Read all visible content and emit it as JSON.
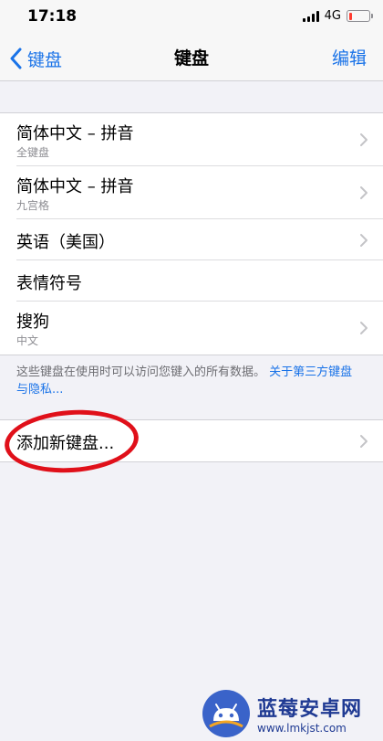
{
  "status": {
    "time": "17:18",
    "network": "4G"
  },
  "nav": {
    "back_label": "键盘",
    "title": "键盘",
    "edit_label": "编辑"
  },
  "keyboards": [
    {
      "title": "简体中文 – 拼音",
      "subtitle": "全键盘"
    },
    {
      "title": "简体中文 – 拼音",
      "subtitle": "九宫格"
    },
    {
      "title": "英语（美国）"
    },
    {
      "title": "表情符号"
    },
    {
      "title": "搜狗",
      "subtitle": "中文"
    }
  ],
  "footer": {
    "note": "这些键盘在使用时可以访问您键入的所有数据。",
    "link": "关于第三方键盘与隐私..."
  },
  "add_keyboard": {
    "label": "添加新键盘..."
  },
  "watermark": {
    "name": "蓝莓安卓网",
    "url": "www.lmkjst.com"
  },
  "colors": {
    "accent": "#1a73e8",
    "highlight": "#e0101a",
    "background": "#f2f2f7"
  }
}
